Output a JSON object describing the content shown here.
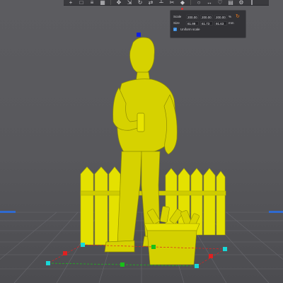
{
  "toolbar": {
    "tools": [
      "add-icon",
      "open-icon",
      "layers-icon",
      "grid-icon",
      "move-icon",
      "scale-icon",
      "rotate-icon",
      "mirror-icon",
      "support-icon",
      "cut-icon",
      "paint-icon",
      "search-icon",
      "measure-icon",
      "heart-icon",
      "layout-icon",
      "settings-icon",
      "split-icon"
    ]
  },
  "scale_panel": {
    "scale_label": "Scale",
    "scale_x": "200.00",
    "scale_y": "200.00",
    "scale_z": "200.00",
    "scale_unit": "%",
    "size_label": "Size",
    "size_x": "61.99",
    "size_y": "61.73",
    "size_z": "91.63",
    "size_unit": "mm",
    "uniform_label": "Uniform scale",
    "uniform_checked": true
  },
  "colors": {
    "model": "#d9d400",
    "model_shadow": "#9a9600",
    "fence": "#e6e300",
    "floor_grid": "#6a6a70",
    "handle_cyan": "#18d8d8",
    "handle_red": "#e02020",
    "handle_green": "#18c018",
    "handle_blue": "#1020e0"
  }
}
